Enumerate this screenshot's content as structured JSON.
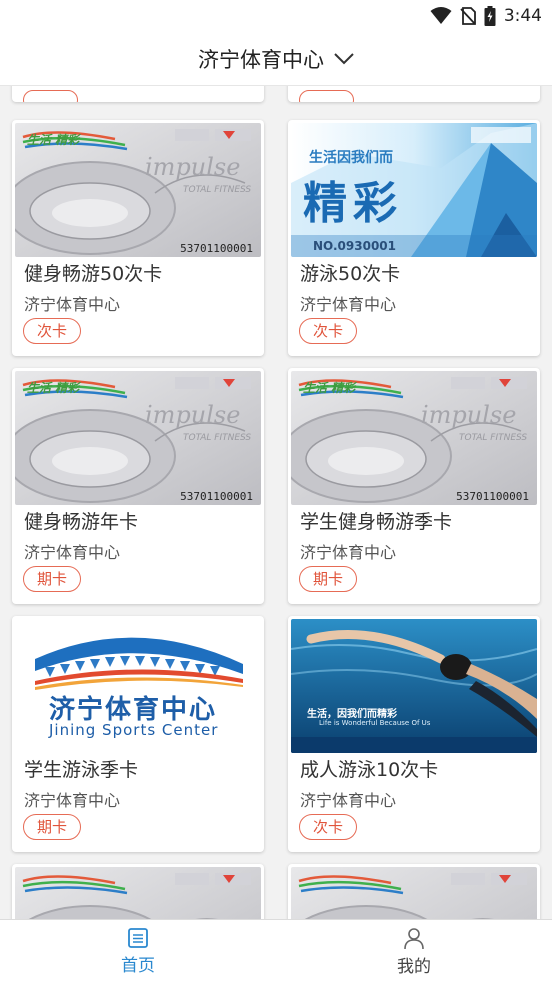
{
  "status_bar": {
    "time": "3:44"
  },
  "header": {
    "title": "济宁体育中心"
  },
  "cards": [
    {
      "name": "健身畅游50次卡",
      "venue": "济宁体育中心",
      "tag": "次卡",
      "image_type": "stadium-gray",
      "card_no": "53701100001",
      "overlay_slogan": "生活 精彩",
      "overlay_brand": "impulse",
      "overlay_sub": "TOTAL FITNESS"
    },
    {
      "name": "游泳50次卡",
      "venue": "济宁体育中心",
      "tag": "次卡",
      "image_type": "blue-card",
      "card_no": "NO.0930001",
      "overlay_slogan": "生活因我们而",
      "overlay_big": "精彩"
    },
    {
      "name": "健身畅游年卡",
      "venue": "济宁体育中心",
      "tag": "期卡",
      "image_type": "stadium-gray",
      "card_no": "53701100001",
      "overlay_slogan": "生活 精彩",
      "overlay_brand": "impulse",
      "overlay_sub": "TOTAL FITNESS"
    },
    {
      "name": "学生健身畅游季卡",
      "venue": "济宁体育中心",
      "tag": "期卡",
      "image_type": "stadium-gray",
      "card_no": "53701100001",
      "overlay_slogan": "生活 精彩",
      "overlay_brand": "impulse",
      "overlay_sub": "TOTAL FITNESS"
    },
    {
      "name": "学生游泳季卡",
      "venue": "济宁体育中心",
      "tag": "期卡",
      "image_type": "logo",
      "logo_cn": "济宁体育中心",
      "logo_en": "Jining Sports Center"
    },
    {
      "name": "成人游泳10次卡",
      "venue": "济宁体育中心",
      "tag": "次卡",
      "image_type": "swimmer",
      "overlay_slogan": "生活，因我们而精彩",
      "overlay_sub": "Life is Wonderful Because Of Us"
    }
  ],
  "tabbar": {
    "home_label": "首页",
    "mine_label": "我的"
  },
  "colors": {
    "accent": "#2a88cf",
    "tag": "#e0543b"
  }
}
